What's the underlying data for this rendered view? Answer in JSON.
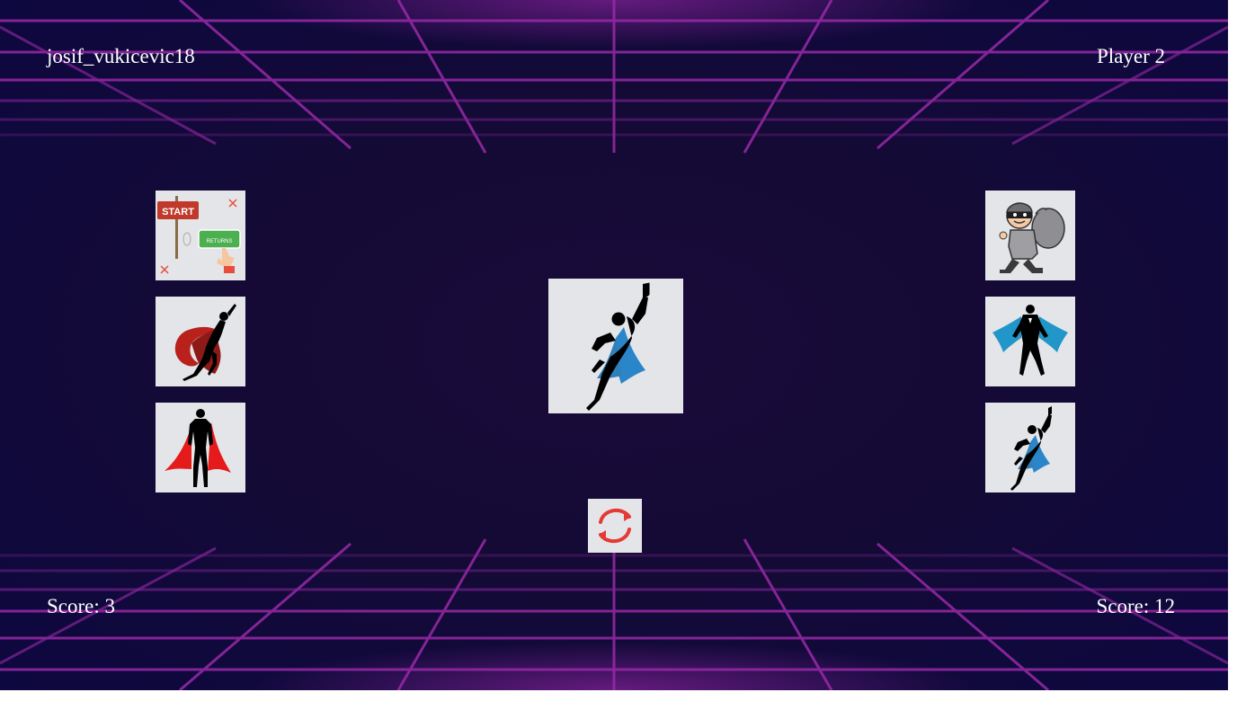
{
  "players": {
    "left": {
      "name": "josif_vukicevic18",
      "score_text": "Score: 3"
    },
    "right": {
      "name": "Player 2",
      "score_text": "Score: 12"
    }
  },
  "cards": {
    "left": [
      {
        "icon": "start-return-sign-icon",
        "small_text": "START",
        "small_text2": "RETURNS"
      },
      {
        "icon": "flying-hero-red-cape-icon"
      },
      {
        "icon": "standing-hero-red-cape-icon"
      }
    ],
    "right": [
      {
        "icon": "thief-with-sack-icon"
      },
      {
        "icon": "hero-blue-cape-icon"
      },
      {
        "icon": "flying-hero-blue-cape-icon"
      }
    ],
    "center": {
      "icon": "flying-hero-blue-cape-icon"
    }
  },
  "controls": {
    "swap_icon": "swap-arrows-icon"
  },
  "colors": {
    "background": "#140a35",
    "grid_line": "#8a2a9e",
    "card_bg": "#e4e5e9",
    "red_cape": "#d41b1b",
    "blue_cape": "#2a86c8",
    "swap_red": "#e53935"
  }
}
